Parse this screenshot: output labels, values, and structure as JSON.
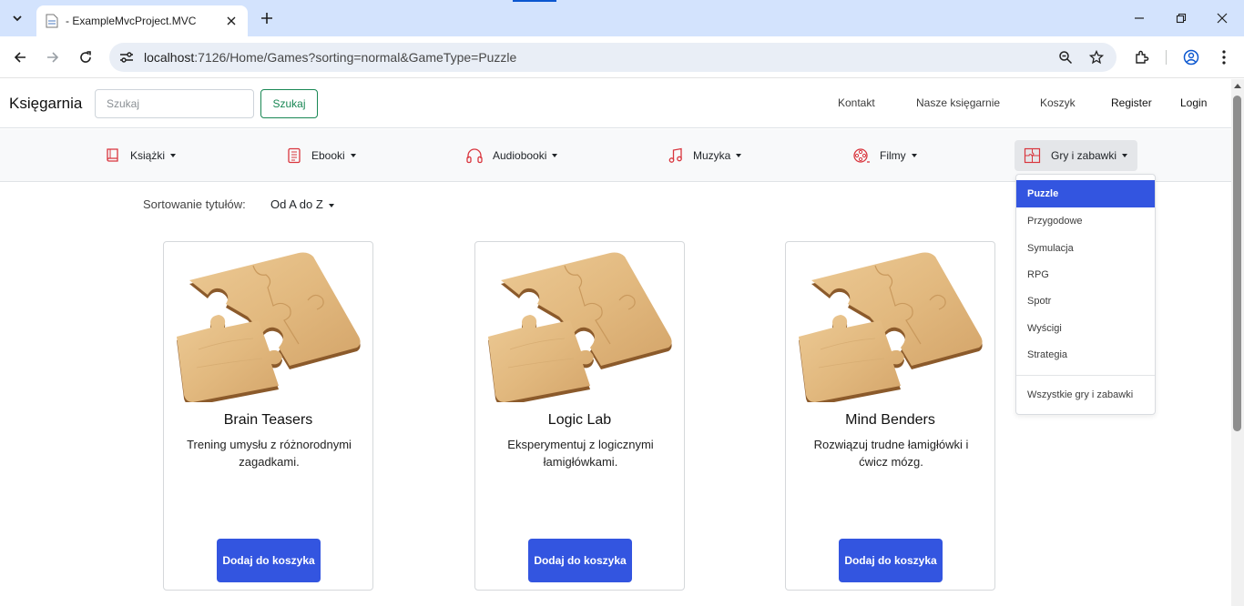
{
  "browser": {
    "tab_title": "- ExampleMvcProject.MVC",
    "url_host": "localhost",
    "url_rest": ":7126/Home/Games?sorting=normal&GameType=Puzzle"
  },
  "header": {
    "brand": "Księgarnia",
    "search_placeholder": "Szukaj",
    "search_button": "Szukaj",
    "links": {
      "contact": "Kontakt",
      "stores": "Nasze księgarnie",
      "cart": "Koszyk",
      "register": "Register",
      "login": "Login"
    }
  },
  "categories": {
    "books": "Książki",
    "ebooks": "Ebooki",
    "audiobooks": "Audiobooki",
    "music": "Muzyka",
    "films": "Filmy",
    "games": "Gry i zabawki"
  },
  "sorting": {
    "label": "Sortowanie tytułów:",
    "value": "Od A do Z"
  },
  "products": [
    {
      "title": "Brain Teasers",
      "description": "Trening umysłu z różnorodnymi zagadkami.",
      "button": "Dodaj do koszyka"
    },
    {
      "title": "Logic Lab",
      "description": "Eksperymentuj z logicznymi łamigłówkami.",
      "button": "Dodaj do koszyka"
    },
    {
      "title": "Mind Benders",
      "description": "Rozwiązuj trudne łamigłówki i ćwicz mózg.",
      "button": "Dodaj do koszyka"
    }
  ],
  "games_menu": {
    "items": [
      "Puzzle",
      "Przygodowe",
      "Symulacja",
      "RPG",
      "Spotr",
      "Wyścigi",
      "Strategia"
    ],
    "active": "Puzzle",
    "all": "Wszystkie gry i zabawki"
  },
  "colors": {
    "accent": "#3355e0",
    "success": "#198754",
    "category_icon": "#d9363e",
    "browser_frame": "#d3e3fd"
  }
}
